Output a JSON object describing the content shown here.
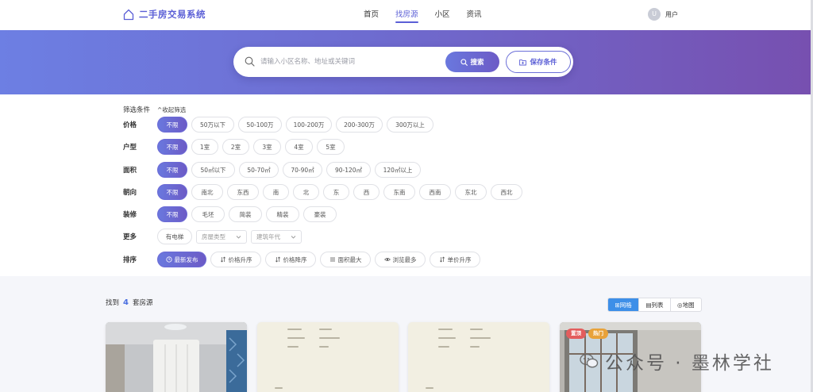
{
  "header": {
    "logo_text": "二手房交易系统",
    "nav": [
      "首页",
      "找房源",
      "小区",
      "资讯"
    ],
    "avatar_initial": "U",
    "user_label": "用户"
  },
  "search": {
    "placeholder": "请输入小区名称、地址或关键词",
    "search_label": "搜索",
    "save_label": "保存条件"
  },
  "filters": {
    "title": "筛选条件",
    "collapse_label": "收起筛选",
    "price": {
      "label": "价格",
      "options": [
        "不限",
        "50万以下",
        "50-100万",
        "100-200万",
        "200-300万",
        "300万以上"
      ]
    },
    "rooms": {
      "label": "户型",
      "options": [
        "不限",
        "1室",
        "2室",
        "3室",
        "4室",
        "5室"
      ]
    },
    "area": {
      "label": "面积",
      "options": [
        "不限",
        "50㎡以下",
        "50-70㎡",
        "70-90㎡",
        "90-120㎡",
        "120㎡以上"
      ]
    },
    "orientation": {
      "label": "朝向",
      "options": [
        "不限",
        "南北",
        "东西",
        "南",
        "北",
        "东",
        "西",
        "东南",
        "西南",
        "东北",
        "西北"
      ]
    },
    "decoration": {
      "label": "装修",
      "options": [
        "不限",
        "毛坯",
        "简装",
        "精装",
        "豪装"
      ]
    },
    "more": {
      "label": "更多",
      "elevator": "有电梯",
      "house_type": "房屋类型",
      "build_year": "建筑年代"
    },
    "sort": {
      "label": "排序",
      "options": [
        "最新发布",
        "价格升序",
        "价格降序",
        "面积最大",
        "浏览最多",
        "单价升序"
      ]
    }
  },
  "results": {
    "prefix": "找到",
    "count": "4",
    "suffix": "套房源",
    "views": [
      "⊞网格",
      "▤列表",
      "◎地图"
    ]
  },
  "cards": {
    "badge_top": "置顶",
    "badge_hot": "热门"
  },
  "watermark": "公众号 · 墨林学社",
  "colors": {
    "accent": "#5b5fd6",
    "hero_start": "#6d7fe3",
    "hero_end": "#7750b0",
    "count": "#4b6fe0",
    "grid_active": "#3d8fe8",
    "badge_top": "#e35d5d",
    "badge_hot": "#e8a23a"
  }
}
